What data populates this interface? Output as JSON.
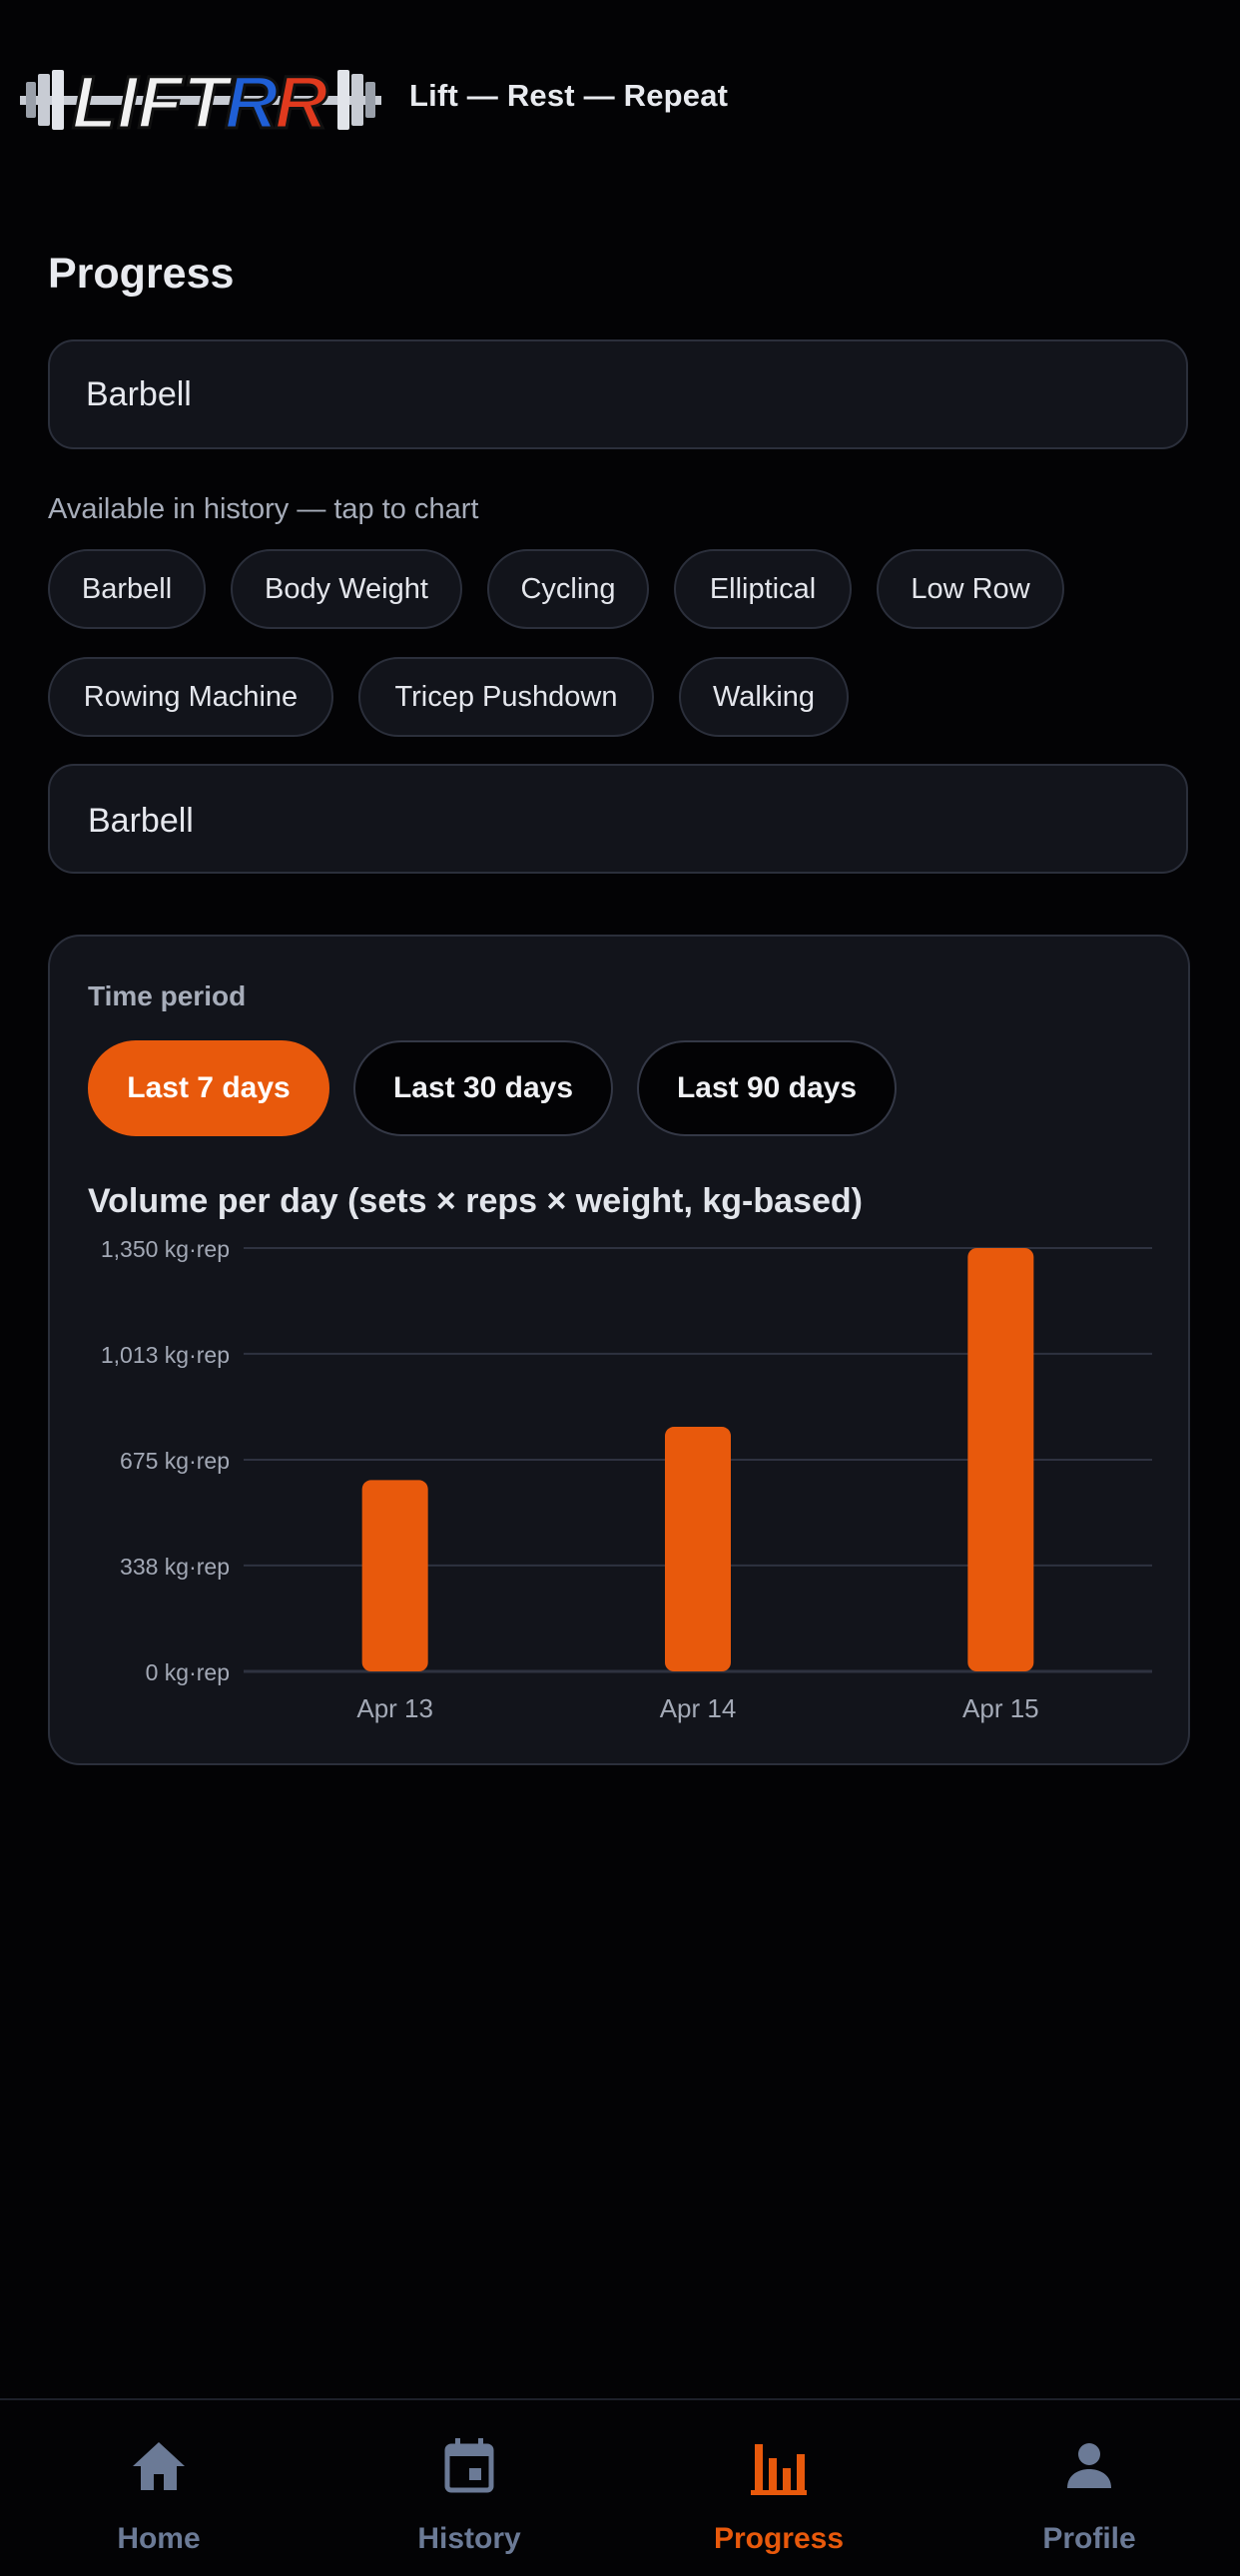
{
  "header": {
    "logo_text": "LIFTRR",
    "tagline": "Lift — Rest — Repeat"
  },
  "page_title": "Progress",
  "search": {
    "value": "Barbell"
  },
  "history_hint": "Available in history — tap to chart",
  "exercise_chips": [
    "Barbell",
    "Body Weight",
    "Cycling",
    "Elliptical",
    "Low Row",
    "Rowing Machine",
    "Tricep Pushdown",
    "Walking"
  ],
  "selected_exercise": "Barbell",
  "time_period": {
    "label": "Time period",
    "options": [
      "Last 7 days",
      "Last 30 days",
      "Last 90 days"
    ],
    "selected": "Last 7 days"
  },
  "colors": {
    "accent": "#e8590c",
    "nav_inactive": "#6b7a96"
  },
  "chart_data": {
    "type": "bar",
    "title": "Volume per day (sets × reps × weight, kg-based)",
    "categories": [
      "Apr 13",
      "Apr 14",
      "Apr 15"
    ],
    "values": [
      610,
      780,
      1350
    ],
    "unit": "kg·rep",
    "ylim": [
      0,
      1350
    ],
    "y_ticks": [
      0,
      338,
      675,
      1013,
      1350
    ],
    "y_tick_labels": [
      "0 kg·rep",
      "338 kg·rep",
      "675 kg·rep",
      "1,013 kg·rep",
      "1,350 kg·rep"
    ],
    "grid": true,
    "bar_color": "#e8590c"
  },
  "bottom_nav": {
    "items": [
      {
        "label": "Home",
        "icon": "home-icon",
        "active": false
      },
      {
        "label": "History",
        "icon": "calendar-icon",
        "active": false
      },
      {
        "label": "Progress",
        "icon": "bar-chart-icon",
        "active": true
      },
      {
        "label": "Profile",
        "icon": "person-icon",
        "active": false
      }
    ]
  }
}
